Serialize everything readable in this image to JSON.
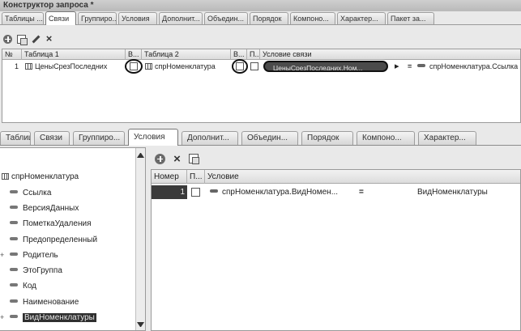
{
  "window": {
    "title": "Конструктор запроса *"
  },
  "top_tabs": [
    "Таблицы ...",
    "Связи",
    "Группиро...",
    "Условия",
    "Дополнит...",
    "Объедин...",
    "Порядок",
    "Компоно...",
    "Характер...",
    "Пакет за..."
  ],
  "top_active_tab": "Связи",
  "links_grid": {
    "columns": [
      "№",
      "Таблица 1",
      "В...",
      "Таблица 2",
      "В...",
      "П...",
      "Условие связи"
    ],
    "rows": [
      {
        "number": "1",
        "table1": "ЦеныСрезПоследних",
        "table2": "спрНоменклатура",
        "condition_left": "ЦеныСрезПоследних.Ном...",
        "condition_op": "=",
        "condition_right": "спрНоменклатура.Ссылка"
      }
    ]
  },
  "bottom_tabs": [
    "Таблицы ...",
    "Связи",
    "Группиро...",
    "Условия",
    "Дополнит...",
    "Объедин...",
    "Порядок",
    "Компоно...",
    "Характер..."
  ],
  "bottom_active_tab": "Условия",
  "fields_tree": {
    "root": "спрНоменклатура",
    "items": [
      "Ссылка",
      "ВерсияДанных",
      "ПометкаУдаления",
      "Предопределенный",
      "Родитель",
      "ЭтоГруппа",
      "Код",
      "Наименование",
      "ВидНоменклатуры"
    ],
    "selected": "ВидНоменклатуры"
  },
  "conditions_grid": {
    "columns": [
      "Номер",
      "П...",
      "Условие"
    ],
    "rows": [
      {
        "number": "1",
        "field": "спрНоменклатура.ВидНомен...",
        "op": "=",
        "value": "ВидНоменклатуры"
      }
    ]
  }
}
